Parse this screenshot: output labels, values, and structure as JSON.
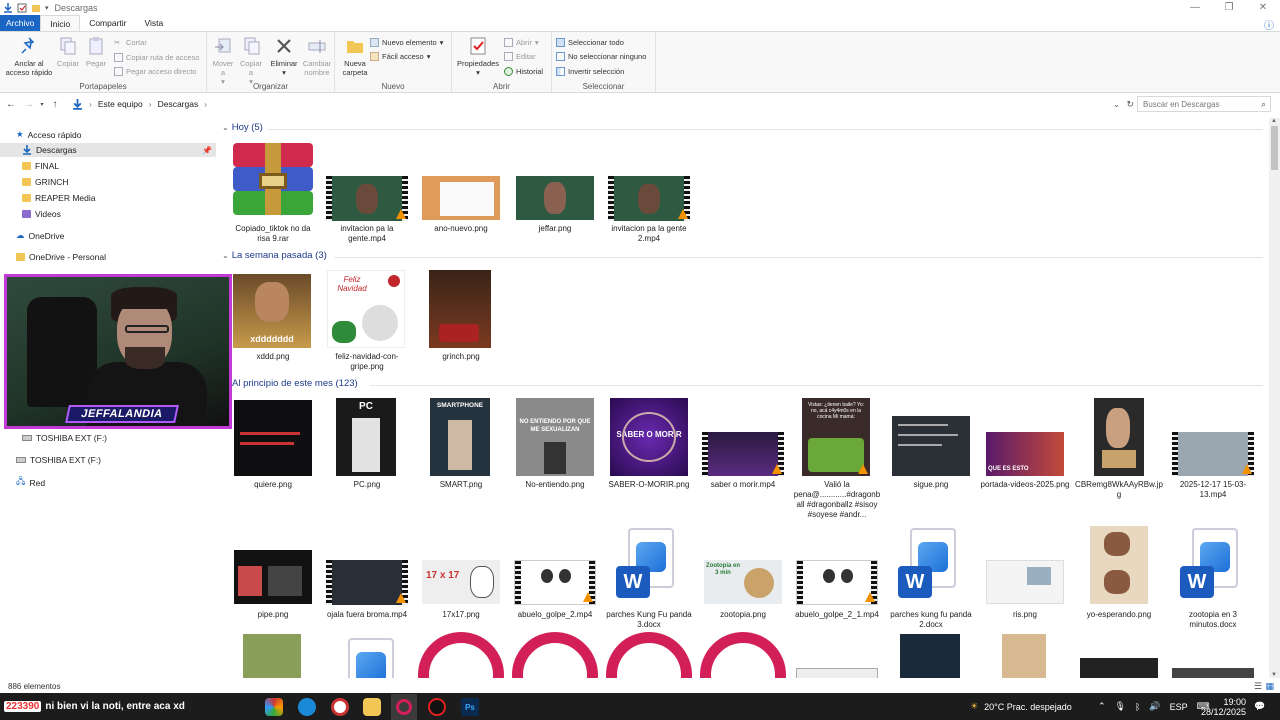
{
  "window": {
    "title": "Descargas"
  },
  "ribbon_tabs": [
    "Archivo",
    "Inicio",
    "Compartir",
    "Vista"
  ],
  "ribbon": {
    "portapapeles": {
      "label": "Portapapeles",
      "pin": "Anclar al acceso rápido",
      "copy": "Copiar",
      "paste": "Pegar",
      "cut": "Cortar",
      "copy_path": "Copiar ruta de acceso",
      "paste_shortcut": "Pegar acceso directo"
    },
    "organizar": {
      "label": "Organizar",
      "move": "Mover a",
      "copy_to": "Copiar a",
      "delete": "Eliminar",
      "rename": "Cambiar nombre"
    },
    "nuevo": {
      "label": "Nuevo",
      "new_folder": "Nueva carpeta",
      "new_item": "Nuevo elemento",
      "easy_access": "Fácil acceso"
    },
    "abrir": {
      "label": "Abrir",
      "properties": "Propiedades",
      "open": "Abrir",
      "edit": "Editar",
      "history": "Historial"
    },
    "seleccionar": {
      "label": "Seleccionar",
      "select_all": "Seleccionar todo",
      "select_none": "No seleccionar ninguno",
      "invert": "Invertir selección"
    }
  },
  "address": {
    "crumbs": [
      "Este equipo",
      "Descargas"
    ],
    "search_placeholder": "Buscar en Descargas"
  },
  "nav": {
    "quick_access": "Acceso rápido",
    "items": [
      "Descargas",
      "FINAL",
      "GRINCH",
      "REAPER Media",
      "Videos"
    ],
    "onedrive": "OneDrive",
    "onedrive_personal": "OneDrive - Personal",
    "drive1": "TOSHIBA EXT (F:)",
    "drive2": "TOSHIBA EXT (F:)",
    "network": "Red"
  },
  "webcam_banner": "JEFFALANDIA",
  "groups": [
    {
      "title": "Hoy (5)",
      "items": [
        "Copiado_tiktok no da risa 9.rar",
        "invitacion pa la gente.mp4",
        "ano-nuevo.png",
        "jeffar.png",
        "invitacion pa la gente 2.mp4"
      ]
    },
    {
      "title": "La semana pasada (3)",
      "items": [
        "xddd.png",
        "feliz-navidad-con-gripe.png",
        "grinch.png"
      ]
    },
    {
      "title": "Al principio de este mes (123)",
      "row1": [
        "quiere.png",
        "PC.png",
        "SMART.png",
        "No-entiendo.png",
        "SABER-O-MORIR.png",
        "saber o morir.mp4",
        "Valió la pena@............#dragonball #dragonballz #sisoy #soyese #andr...",
        "sigue.png",
        "portada-videos-2025.png",
        "CBRemg8WkAAyRBw.jpg",
        "2025-12-17 15-03-13.mp4"
      ],
      "row2": [
        "pipe.png",
        "ojala fuera broma.mp4",
        "17x17.png",
        "abuelo_golpe_2.mp4",
        "parches Kung Fu panda 3.docx",
        "zootopia.png",
        "abuelo_golpe_2_1.mp4",
        "parches kung fu panda 2.docx",
        "ris.png",
        "yo-esperando.png",
        "zootopia en 3 minutos.docx"
      ]
    }
  ],
  "thumb_text": {
    "pc": "PC",
    "smart": "SMARTPHONE",
    "noent": "NO ENTIENDO POR QUE ME SEXUALIZAN",
    "saber": "SABER O MORIR",
    "xddd": "xddddddd",
    "feliz": "Feliz Navidad",
    "x17": "17 x 17",
    "zoo": "Zootopia en 3 min",
    "valio": "Vistas: ¿tienen baile? Yo: no, acá c4y4m0s en la cocina Mi mamá:",
    "portada": "QUE ES ESTO"
  },
  "status": {
    "count": "886 elementos"
  },
  "taskbar": {
    "chat_user": "223390",
    "chat_text": "ni bien vi la noti, entre aca xd",
    "weather": "20°C  Prac. despejado",
    "lang": "ESP",
    "time": "19:00",
    "date": "28/12/2025"
  },
  "colors": {
    "file_tab": "#1a66c2",
    "group_header": "#1e3a8a",
    "webcam_border": "#c23ad6",
    "opera": "#d21f57"
  }
}
